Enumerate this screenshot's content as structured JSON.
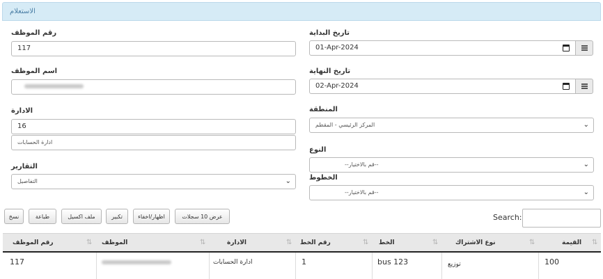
{
  "panel": {
    "title": "الاستعلام"
  },
  "form": {
    "employee_number": {
      "label": "رقم الموظف",
      "value": "117"
    },
    "employee_name": {
      "label": "اسم الموظف"
    },
    "department": {
      "label": "الادارة",
      "code": "16",
      "name": "ادارة الحسابات"
    },
    "reports": {
      "label": "التقارير",
      "value": "التفاصيل"
    },
    "start_date": {
      "label": "تاريخ البداية",
      "value": "01-Apr-2024"
    },
    "end_date": {
      "label": "تاريخ النهاية",
      "value": "02-Apr-2024"
    },
    "region": {
      "label": "المنطقة",
      "value": "المركز الرئيسي - المقطم"
    },
    "type": {
      "label": "النوع",
      "placeholder": "--قم بالاختيار--"
    },
    "lines": {
      "label": "الخطوط",
      "placeholder": "--قم بالاختيار--"
    }
  },
  "toolbar": {
    "copy": "نسخ",
    "print": "طباعة",
    "excel": "ملف اكسيل",
    "expand": "تكبير",
    "toggle": "اظهار/اخفاء",
    "show_records": "عرض 10 سجلات"
  },
  "search": {
    "label": "Search:"
  },
  "table": {
    "columns": [
      "القيمة",
      "نوع الاشتراك",
      "الخط",
      "رقم الخط",
      "الادارة",
      "الموظف",
      "رقم الموظف"
    ],
    "sort_icon": "sort-arrows-icon",
    "rows": [
      {
        "value": "100",
        "subscription_type": "توزيع",
        "line": "bus 123",
        "line_number": "1",
        "department": "ادارة الحسابات",
        "employee_number": "117"
      }
    ]
  },
  "colors": {
    "panel_header_bg": "#d6ebf6",
    "panel_title": "#4a7ea5",
    "table_header_bg": "#e8e8e8"
  }
}
